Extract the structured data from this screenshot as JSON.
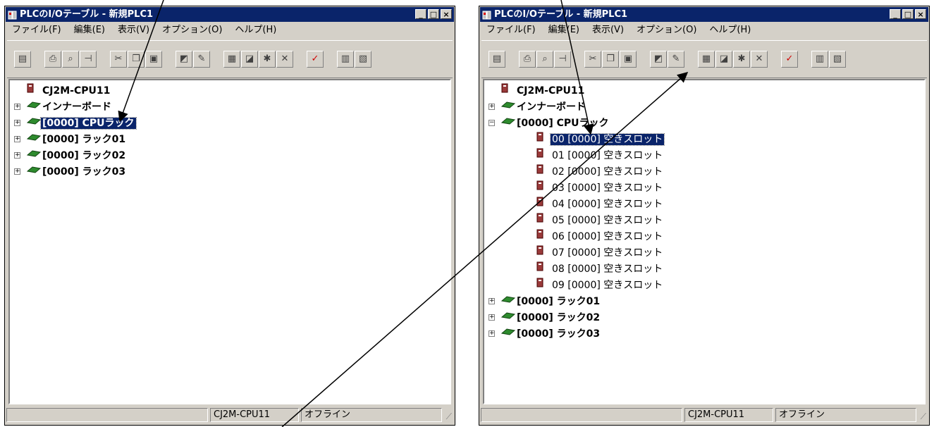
{
  "window_title": "PLCのI/Oテーブル - 新規PLC1",
  "menu": [
    "ファイル(F)",
    "編集(E)",
    "表示(V)",
    "オプション(O)",
    "ヘルプ(H)"
  ],
  "titlebar_buttons": [
    "minimize",
    "maximize",
    "close"
  ],
  "toolbar_icons": [
    "cps-icon",
    "print-icon",
    "print-preview-icon",
    "pin-icon",
    "cut-icon",
    "copy-icon",
    "paste-icon",
    "io-table-icon",
    "edit-icon",
    "unit-icon",
    "settings-icon",
    "new-unit-icon",
    "delete-icon",
    "check-icon",
    "compare-icon",
    "transfer-icon"
  ],
  "left_window": {
    "tree": [
      {
        "label": "CJ2M-CPU11",
        "level": 0
      },
      {
        "label": "インナーボード",
        "level": 0
      },
      {
        "label": "[0000] CPUラック",
        "level": 0,
        "selected": true
      },
      {
        "label": "[0000] ラック01",
        "level": 0
      },
      {
        "label": "[0000] ラック02",
        "level": 0
      },
      {
        "label": "[0000] ラック03",
        "level": 0
      }
    ]
  },
  "right_window": {
    "tree": [
      {
        "label": "CJ2M-CPU11",
        "level": 0
      },
      {
        "label": "インナーボード",
        "level": 0
      },
      {
        "label": "[0000] CPUラック",
        "level": 0,
        "expanded": true
      },
      {
        "label": "00 [0000] 空きスロット",
        "level": 1,
        "selected": true
      },
      {
        "label": "01 [0000] 空きスロット",
        "level": 1
      },
      {
        "label": "02 [0000] 空きスロット",
        "level": 1
      },
      {
        "label": "03 [0000] 空きスロット",
        "level": 1
      },
      {
        "label": "04 [0000] 空きスロット",
        "level": 1
      },
      {
        "label": "05 [0000] 空きスロット",
        "level": 1
      },
      {
        "label": "06 [0000] 空きスロット",
        "level": 1
      },
      {
        "label": "07 [0000] 空きスロット",
        "level": 1
      },
      {
        "label": "08 [0000] 空きスロット",
        "level": 1
      },
      {
        "label": "09 [0000] 空きスロット",
        "level": 1
      },
      {
        "label": "[0000] ラック01",
        "level": 0
      },
      {
        "label": "[0000] ラック02",
        "level": 0
      },
      {
        "label": "[0000] ラック03",
        "level": 0
      }
    ]
  },
  "status": {
    "model": "CJ2M-CPU11",
    "mode": "オフライン"
  }
}
